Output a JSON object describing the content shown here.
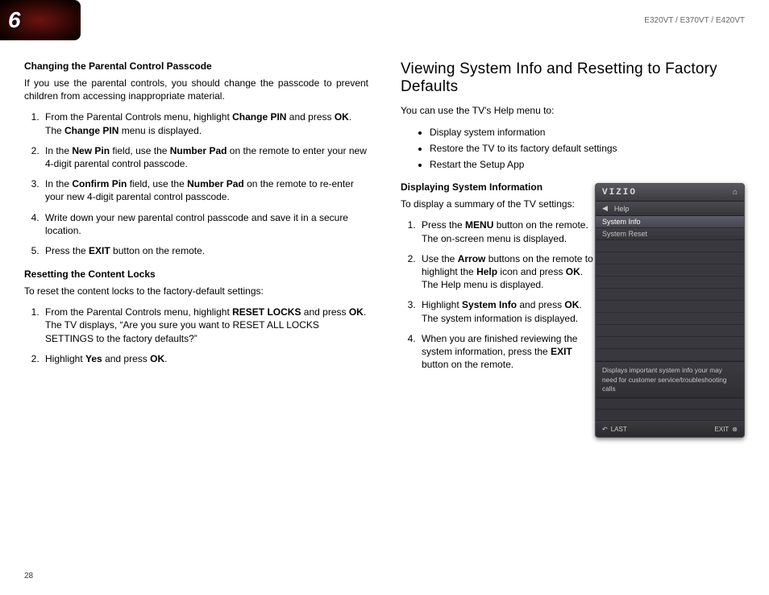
{
  "header": {
    "page_badge": "6",
    "models": "E320VT / E370VT / E420VT"
  },
  "left": {
    "h1": "Changing the Parental Control Passcode",
    "p1": "If you use the parental controls, you should change the passcode to prevent children from accessing inappropriate material.",
    "steps1": [
      {
        "pre": "From the Parental Controls menu, highlight ",
        "b1": "Change PIN",
        "mid": " and press ",
        "b2": "OK",
        "post": ". The ",
        "b3": "Change PIN",
        "end": " menu is displayed."
      },
      {
        "pre": "In the ",
        "b1": "New Pin",
        "mid": " field, use the ",
        "b2": "Number Pad",
        "post": " on the remote to enter your new 4-digit parental control passcode.",
        "b3": "",
        "end": ""
      },
      {
        "pre": "In the ",
        "b1": "Confirm Pin",
        "mid": " field, use the ",
        "b2": "Number Pad",
        "post": " on the remote to re-enter your new 4-digit parental control passcode.",
        "b3": "",
        "end": ""
      },
      {
        "pre": "Write down your new parental control passcode and save it in a secure location.",
        "b1": "",
        "mid": "",
        "b2": "",
        "post": "",
        "b3": "",
        "end": ""
      },
      {
        "pre": "Press the ",
        "b1": "EXIT",
        "mid": " button on the remote.",
        "b2": "",
        "post": "",
        "b3": "",
        "end": ""
      }
    ],
    "h2": "Resetting the Content Locks",
    "p2": "To reset the content locks to the factory-default settings:",
    "steps2": [
      {
        "pre": "From the Parental Controls menu, highlight ",
        "b1": "RESET LOCKS",
        "mid": " and press ",
        "b2": "OK",
        "post": ". The TV displays, “Are you sure you want to RESET ALL LOCKS SETTINGS to the factory defaults?”",
        "b3": "",
        "end": ""
      },
      {
        "pre": "Highlight ",
        "b1": "Yes",
        "mid": " and press ",
        "b2": "OK",
        "post": ".",
        "b3": "",
        "end": ""
      }
    ]
  },
  "right": {
    "title": "Viewing System Info and Resetting to Factory Defaults",
    "intro": "You can use the TV's Help menu to:",
    "bullets": [
      "Display system information",
      "Restore the TV to its factory default settings",
      "Restart the Setup App"
    ],
    "h1": "Displaying System Information",
    "p1": "To display a summary of the TV settings:",
    "steps": [
      {
        "pre": "Press the ",
        "b1": "MENU",
        "mid": " button on the remote. The on-screen menu is displayed.",
        "b2": "",
        "post": "",
        "b3": "",
        "end": ""
      },
      {
        "pre": "Use the ",
        "b1": "Arrow",
        "mid": " buttons on the remote to highlight the ",
        "b2": "Help",
        "post": " icon and press ",
        "b3": "OK",
        "end": ". The Help menu is displayed."
      },
      {
        "pre": "Highlight ",
        "b1": "System Info",
        "mid": " and press ",
        "b2": "OK",
        "post": ". The system information is displayed.",
        "b3": "",
        "end": ""
      },
      {
        "pre": "When you are finished reviewing the system information, press the ",
        "b1": "EXIT",
        "mid": " button on the remote.",
        "b2": "",
        "post": "",
        "b3": "",
        "end": ""
      }
    ]
  },
  "tv": {
    "logo": "VIZIO",
    "breadcrumb": "Help",
    "items": [
      "System Info",
      "System Reset"
    ],
    "desc": "Displays important system info your may need for customer service/troubleshooting calls",
    "last": "LAST",
    "exit": "EXIT"
  },
  "footer": {
    "page": "28"
  }
}
